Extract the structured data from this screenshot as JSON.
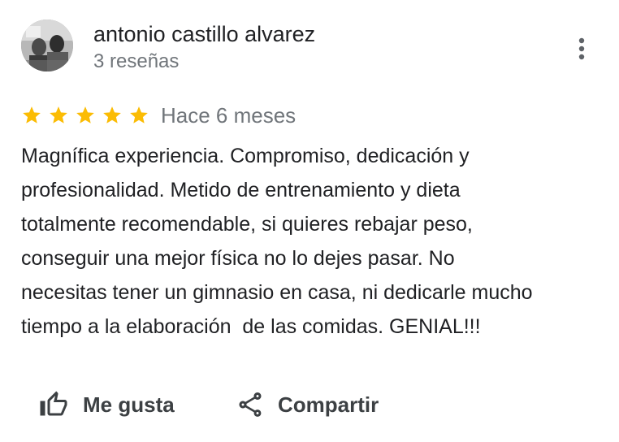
{
  "review": {
    "author_name": "antonio castillo alvarez",
    "review_count": "3 reseñas",
    "rating": 5,
    "max_rating": 5,
    "date": "Hace 6 meses",
    "text": "Magnífica experiencia. Compromiso, dedicación y\nprofesionalidad. Metido de entrenamiento y dieta\ntotalmente recomendable, si quieres rebajar peso,\nconseguir una mejor física no lo dejes pasar. No\nnecesitas tener un gimnasio en casa, ni dedicarle mucho\ntiempo a la elaboración  de las comidas. GENIAL!!!"
  },
  "actions": {
    "like_label": "Me gusta",
    "share_label": "Compartir"
  },
  "icons": {
    "more": "more-vert-icon",
    "star": "star-icon",
    "like": "thumb-up-icon",
    "share": "share-icon"
  },
  "colors": {
    "star": "#fbbc04",
    "secondary_text": "#70757a",
    "primary_text": "#202124",
    "icon": "#5f6368"
  }
}
